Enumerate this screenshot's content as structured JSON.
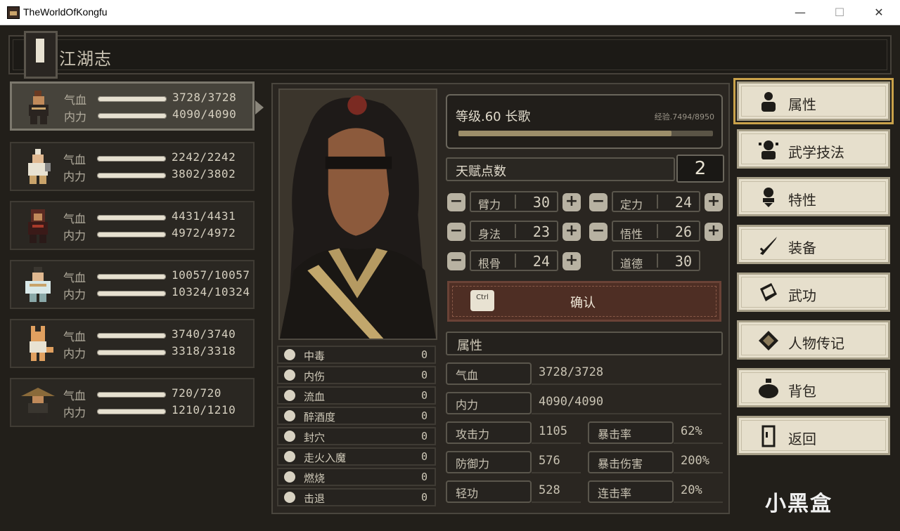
{
  "window": {
    "title": "TheWorldOfKongfu",
    "minimize": "—",
    "maximize": "☐",
    "close": "✕"
  },
  "header": {
    "title": "江湖志"
  },
  "party": [
    {
      "hp_label": "气血",
      "hp": "3728/3728",
      "mp_label": "内力",
      "mp": "4090/4090"
    },
    {
      "hp_label": "气血",
      "hp": "2242/2242",
      "mp_label": "内力",
      "mp": "3802/3802"
    },
    {
      "hp_label": "气血",
      "hp": "4431/4431",
      "mp_label": "内力",
      "mp": "4972/4972"
    },
    {
      "hp_label": "气血",
      "hp": "10057/10057",
      "mp_label": "内力",
      "mp": "10324/10324"
    },
    {
      "hp_label": "气血",
      "hp": "3740/3740",
      "mp_label": "内力",
      "mp": "3318/3318"
    },
    {
      "hp_label": "气血",
      "hp": "720/720",
      "mp_label": "内力",
      "mp": "1210/1210"
    }
  ],
  "character": {
    "level_line": "等级.60  长歌",
    "exp_line": "经验.7494/8950",
    "exp_fraction": 0.837
  },
  "talent": {
    "label": "天赋点数",
    "value": "2"
  },
  "attributes": {
    "minus": "−",
    "plus": "+",
    "strength": {
      "label": "臂力",
      "value": "30"
    },
    "focus": {
      "label": "定力",
      "value": "24"
    },
    "agility": {
      "label": "身法",
      "value": "23"
    },
    "insight": {
      "label": "悟性",
      "value": "26"
    },
    "constitution": {
      "label": "根骨",
      "value": "24"
    },
    "morality": {
      "label": "道德",
      "value": "30"
    }
  },
  "confirm": {
    "key": "Ctrl",
    "label": "确认"
  },
  "status_effects": [
    {
      "name": "中毒",
      "value": "0"
    },
    {
      "name": "内伤",
      "value": "0"
    },
    {
      "name": "流血",
      "value": "0"
    },
    {
      "name": "醉酒度",
      "value": "0"
    },
    {
      "name": "封穴",
      "value": "0"
    },
    {
      "name": "走火入魔",
      "value": "0"
    },
    {
      "name": "燃烧",
      "value": "0"
    },
    {
      "name": "击退",
      "value": "0"
    }
  ],
  "properties": {
    "heading": "属性",
    "hp": {
      "label": "气血",
      "value": "3728/3728"
    },
    "mp": {
      "label": "内力",
      "value": "4090/4090"
    },
    "attack": {
      "label": "攻击力",
      "value": "1105"
    },
    "crit_rate": {
      "label": "暴击率",
      "value": "62%"
    },
    "defense": {
      "label": "防御力",
      "value": "576"
    },
    "crit_damage": {
      "label": "暴击伤害",
      "value": "200%"
    },
    "lightness": {
      "label": "轻功",
      "value": "528"
    },
    "combo_rate": {
      "label": "连击率",
      "value": "20%"
    }
  },
  "menu": [
    {
      "label": "属性",
      "icon": "person-icon"
    },
    {
      "label": "武学技法",
      "icon": "martial-skill-icon"
    },
    {
      "label": "特性",
      "icon": "trait-icon"
    },
    {
      "label": "装备",
      "icon": "sword-icon"
    },
    {
      "label": "武功",
      "icon": "book-icon"
    },
    {
      "label": "人物传记",
      "icon": "scroll-icon"
    },
    {
      "label": "背包",
      "icon": "bag-icon"
    },
    {
      "label": "返回",
      "icon": "door-icon"
    }
  ],
  "watermark": "小黑盒"
}
